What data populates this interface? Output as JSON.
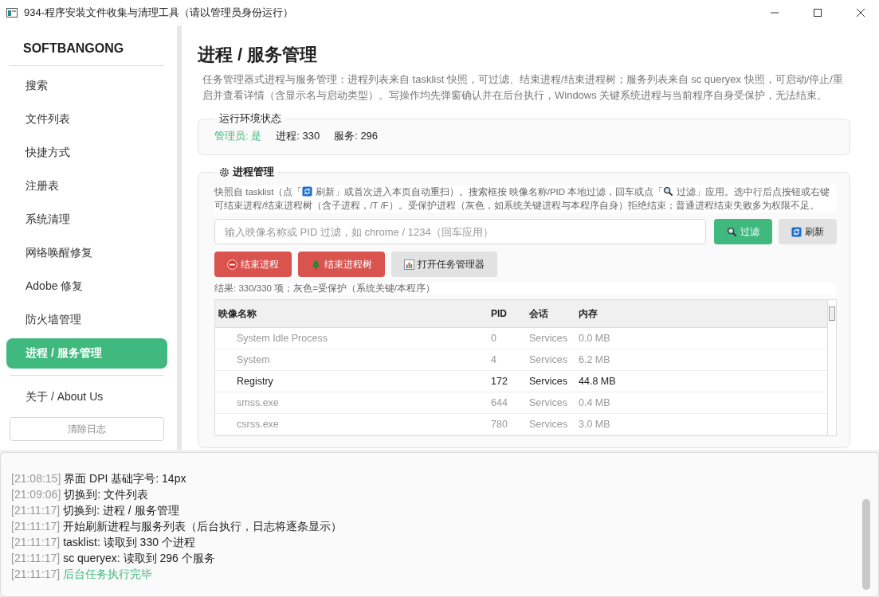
{
  "window": {
    "title": "934-程序安装文件收集与清理工具（请以管理员身份运行）"
  },
  "sidebar": {
    "brand": "SOFTBANGONG",
    "items": [
      {
        "label": "搜索",
        "selected": false
      },
      {
        "label": "文件列表",
        "selected": false
      },
      {
        "label": "快捷方式",
        "selected": false
      },
      {
        "label": "注册表",
        "selected": false
      },
      {
        "label": "系统清理",
        "selected": false
      },
      {
        "label": "网络唤醒修复",
        "selected": false
      },
      {
        "label": "Adobe 修复",
        "selected": false
      },
      {
        "label": "防火墙管理",
        "selected": false
      },
      {
        "label": "进程 / 服务管理",
        "selected": true
      },
      {
        "label": "关于 / About Us",
        "selected": false
      }
    ],
    "clear_log_button": "清除日志"
  },
  "page": {
    "title": "进程 / 服务管理",
    "description": "任务管理器式进程与服务管理：进程列表来自 tasklist 快照，可过滤、结束进程/结束进程树；服务列表来自 sc queryex 快照，可启动/停止/重启并查看详情（含显示名与启动类型）。写操作均先弹窗确认并在后台执行，Windows 关键系统进程与当前程序自身受保护，无法结束。"
  },
  "env_status": {
    "title": "运行环境状态",
    "admin": "管理员: 是",
    "processes": "进程: 330",
    "services": "服务: 296"
  },
  "process_panel": {
    "title": "进程管理",
    "hint_parts": [
      "快照自 tasklist（点「",
      "刷新」或首次进入本页自动重扫）。搜索框按 映像名称/PID 本地过滤，回车或点「",
      "过滤」应用。选中行后点按钮或右键可结束进程/结束进程树（含子进程，/T /F）。受保护进程（灰色，如系统关键进程与本程序自身）拒绝结束；普通进程结束失败多为权限不足。"
    ],
    "search": {
      "placeholder": "输入映像名称或 PID 过滤，如 chrome / 1234（回车应用）"
    },
    "search_buttons": [
      {
        "label": "过滤",
        "kind": "primary"
      },
      {
        "label": "刷新",
        "kind": "secondary"
      }
    ],
    "action_buttons": [
      {
        "label": "结束进程",
        "kind": "danger"
      },
      {
        "label": "结束进程树",
        "kind": "danger"
      },
      {
        "label": "打开任务管理器",
        "kind": "secondary"
      }
    ],
    "result": "结果: 330/330 项；灰色=受保护（系统关键/本程序）",
    "table": {
      "columns": [
        "映像名称",
        "PID",
        "会话",
        "内存"
      ],
      "rows": [
        {
          "name": "System Idle Process",
          "pid": "0",
          "session": "Services",
          "memory": "0.0 MB",
          "protected": true
        },
        {
          "name": "System",
          "pid": "4",
          "session": "Services",
          "memory": "6.2 MB",
          "protected": true
        },
        {
          "name": "Registry",
          "pid": "172",
          "session": "Services",
          "memory": "44.8 MB",
          "protected": false
        },
        {
          "name": "smss.exe",
          "pid": "644",
          "session": "Services",
          "memory": "0.4 MB",
          "protected": true
        },
        {
          "name": "csrss.exe",
          "pid": "780",
          "session": "Services",
          "memory": "3.0 MB",
          "protected": true
        }
      ]
    }
  },
  "log": [
    {
      "time": "[21:08:15]",
      "text": "界面 DPI 基础字号: 14px",
      "kind": "info"
    },
    {
      "time": "[21:09:06]",
      "text": "切换到: 文件列表",
      "kind": "info"
    },
    {
      "time": "[21:11:17]",
      "text": "切换到: 进程 / 服务管理",
      "kind": "info"
    },
    {
      "time": "[21:11:17]",
      "text": "开始刷新进程与服务列表（后台执行，日志将逐条显示）",
      "kind": "info"
    },
    {
      "time": "[21:11:17]",
      "text": "tasklist: 读取到 330 个进程",
      "kind": "info"
    },
    {
      "time": "[21:11:17]",
      "text": "sc queryex: 读取到 296 个服务",
      "kind": "info"
    },
    {
      "time": "[21:11:17]",
      "text": "后台任务执行完毕",
      "kind": "success"
    }
  ]
}
